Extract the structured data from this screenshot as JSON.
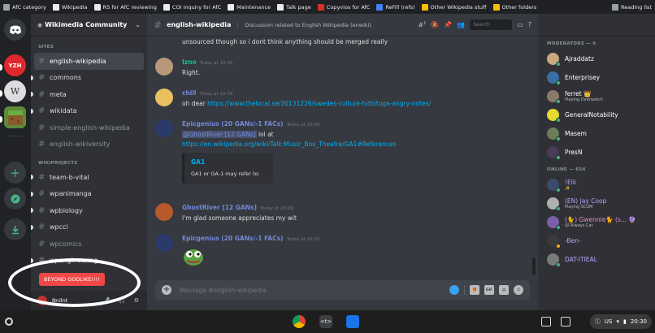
{
  "bookmarks": {
    "items": [
      {
        "label": "AfC category",
        "color": "#9aa0a6"
      },
      {
        "label": "Wikipedia",
        "color": "#e8eaed"
      },
      {
        "label": "RS for AfC reviewing",
        "color": "#e8eaed"
      },
      {
        "label": "COI inquiry for AfC",
        "color": "#e8eaed"
      },
      {
        "label": "Maintenance",
        "color": "#e8eaed"
      },
      {
        "label": "Talk page",
        "color": "#e8eaed"
      },
      {
        "label": "Copyvios for AfC",
        "color": "#d93025"
      },
      {
        "label": "ReFill (refs)",
        "color": "#4285f4"
      },
      {
        "label": "Other Wikipedia stuff",
        "color": "#fbbc04"
      },
      {
        "label": "Other folders",
        "color": "#fbbc04"
      }
    ],
    "reading_list": "Reading list"
  },
  "servers": [
    {
      "name": "discord-home",
      "label": "",
      "color": "#36393f"
    },
    {
      "name": "server-yzh",
      "label": "YZH",
      "color": "#e0272d"
    },
    {
      "name": "server-wikipedia",
      "label": "W",
      "color": "#dcddde"
    },
    {
      "name": "server-minecraft",
      "label": "",
      "color": "#5d8a3a"
    },
    {
      "name": "add-server",
      "label": "+",
      "color": "#36393f"
    },
    {
      "name": "explore-servers",
      "label": "",
      "color": "#36393f"
    },
    {
      "name": "download-apps",
      "label": "",
      "color": "#36393f"
    }
  ],
  "sidebar": {
    "guild_name": "Wikimedia Community",
    "sites_label": "SITES",
    "sites": [
      {
        "label": "english-wikipedia",
        "state": "active"
      },
      {
        "label": "commons",
        "state": "unread"
      },
      {
        "label": "meta",
        "state": "unread"
      },
      {
        "label": "wikidata",
        "state": "unread"
      },
      {
        "label": "simple-english-wikipedia",
        "state": "read"
      },
      {
        "label": "english-wikiversity",
        "state": "read"
      }
    ],
    "projects_label": "WIKIPROJECTS",
    "projects": [
      {
        "label": "team-b-vital",
        "state": "unread"
      },
      {
        "label": "wpanimanga",
        "state": "unread"
      },
      {
        "label": "wpbiology",
        "state": "unread"
      },
      {
        "label": "wpcci",
        "state": "unread"
      },
      {
        "label": "wpcomics",
        "state": "read"
      },
      {
        "label": "wpengineering",
        "state": "unread"
      }
    ],
    "toast": "BEYOND GODLIKE!!!!",
    "username": "Nnilnt"
  },
  "chat": {
    "channel": "english-wikipedia",
    "topic": "Discussion related to English Wikipedia (enwiki)",
    "pinned_count": "1",
    "search_placeholder": "Search",
    "top_line": "unsourced though so i dont think anything should be merged really",
    "messages": [
      {
        "author": "Izno",
        "color": "#1abc9c",
        "time": "Today at 19:36",
        "text": "Right."
      },
      {
        "author": "chill",
        "color": "#7289da",
        "time": "Today at 19:38",
        "pre": "oh dear ",
        "link": "https://www.thelocal.se/20131226/swedes-culture-tvttstuga-angry-notes/"
      },
      {
        "author": "Epicgenius (20 GANs/-1 FACs)",
        "color": "#7289da",
        "time": "Today at 20:09",
        "mention": "@GhostRiver [12 GANs]",
        "post": " lol at",
        "link": "https://en.wikipedia.org/wiki/Talk:Music_Box_Theatre/GA1#References",
        "embed_title": "GA1",
        "embed_desc": "GA1 or GA-1 may refer to:"
      },
      {
        "author": "GhostRiver [12 GANs]",
        "color": "#7289da",
        "time": "Today at 20:09",
        "text": "I'm glad someone appreciates my wit"
      },
      {
        "author": "Epicgenius (20 GANs/-1 FACs)",
        "color": "#7289da",
        "time": "Today at 20:10",
        "text": ""
      }
    ],
    "composer_placeholder": "Message #english-wikipedia"
  },
  "members": {
    "moderators_label": "MODERATORS — 6",
    "moderators": [
      {
        "name": "Ajraddatz",
        "sub": "",
        "color": "#ffffff",
        "avatar": "#c9a97e",
        "status": "#43b581"
      },
      {
        "name": "Enterprisey",
        "sub": "",
        "color": "#ffffff",
        "avatar": "#3a6ea5",
        "status": "#43b581"
      },
      {
        "name": "ferret 👑",
        "sub": "Playing Overwatch",
        "color": "#ffffff",
        "avatar": "#8a7a6a",
        "status": "#43b581"
      },
      {
        "name": "GeneralNotability",
        "sub": "",
        "color": "#ffffff",
        "avatar": "#e6d92f",
        "status": "#43b581"
      },
      {
        "name": "Masem",
        "sub": "",
        "color": "#ffffff",
        "avatar": "#6b7d5a",
        "status": "#43b581"
      },
      {
        "name": "PresN",
        "sub": "",
        "color": "#ffffff",
        "avatar": "#4a3a5a",
        "status": "#43b581"
      }
    ],
    "online_label": "ONLINE — 654",
    "online": [
      {
        "name": "!Elli",
        "sub": "✨",
        "color": "#b9a3f5",
        "avatar": "#3c4a6e",
        "status": "#43b581"
      },
      {
        "name": "(EN) Jay Coop",
        "sub": "Playing SCUM",
        "color": "#b9a3f5",
        "avatar": "#b0b0b0",
        "status": "#43b581"
      },
      {
        "name": "(🐈) Gwennie🐈 (s... 🔮",
        "sub": "🐱 Always Cat",
        "color": "#e58cc7",
        "avatar": "#7a5fa8",
        "status": "#43b581"
      },
      {
        "name": "-Ben-",
        "sub": "",
        "color": "#b9a3f5",
        "avatar": "#3a3a3a",
        "status": "#faa61a"
      },
      {
        "name": "DAT-ITIEAL",
        "sub": "",
        "color": "#b9a3f5",
        "avatar": "#7a7a7a",
        "status": "#43b581"
      }
    ]
  },
  "taskbar": {
    "locale": "US",
    "time": "20:30"
  }
}
